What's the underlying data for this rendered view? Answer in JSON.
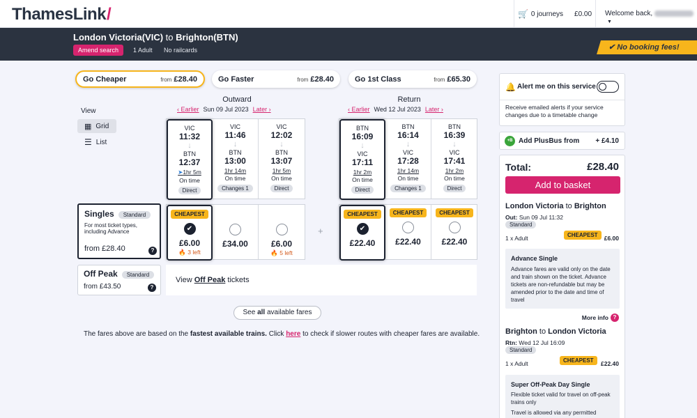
{
  "header": {
    "logo_text": "ThamesLink",
    "logo_slash": "/",
    "basket_journeys": "0 journeys",
    "basket_total": "£0.00",
    "welcome": "Welcome back,"
  },
  "journey": {
    "from": "London Victoria(VIC)",
    "to_word": "to",
    "to": "Brighton(BTN)",
    "amend_label": "Amend search",
    "passengers": "1 Adult",
    "railcards": "No railcards",
    "no_booking_fees": "No booking fees!"
  },
  "tabs": [
    {
      "label": "Go Cheaper",
      "from_word": "from",
      "price": "£28.40",
      "selected": true
    },
    {
      "label": "Go Faster",
      "from_word": "from",
      "price": "£28.40",
      "selected": false
    },
    {
      "label": "Go 1st Class",
      "from_word": "from",
      "price": "£65.30",
      "selected": false
    }
  ],
  "view": {
    "label": "View",
    "grid": "Grid",
    "list": "List"
  },
  "outward": {
    "title": "Outward",
    "earlier": "Earlier",
    "date": "Sun 09 Jul 2023",
    "later": "Later",
    "journeys": [
      {
        "from": "VIC",
        "dep": "11:32",
        "to": "BTN",
        "arr": "12:37",
        "duration": "1hr 5m",
        "status": "On time",
        "changes": "Direct",
        "selected": true
      },
      {
        "from": "VIC",
        "dep": "11:46",
        "to": "BTN",
        "arr": "13:00",
        "duration": "1hr 14m",
        "status": "On time",
        "changes": "Changes 1",
        "selected": false
      },
      {
        "from": "VIC",
        "dep": "12:02",
        "to": "BTN",
        "arr": "13:07",
        "duration": "1hr 5m",
        "status": "On time",
        "changes": "Direct",
        "selected": false
      }
    ],
    "fares": [
      {
        "badge": "CHEAPEST",
        "price": "£6.00",
        "left": "3 left",
        "selected": true
      },
      {
        "badge": "",
        "price": "£34.00",
        "left": "",
        "selected": false
      },
      {
        "badge": "",
        "price": "£6.00",
        "left": "5 left",
        "selected": false
      }
    ]
  },
  "return": {
    "title": "Return",
    "earlier": "Earlier",
    "date": "Wed 12 Jul 2023",
    "later": "Later",
    "journeys": [
      {
        "from": "BTN",
        "dep": "16:09",
        "to": "VIC",
        "arr": "17:11",
        "duration": "1hr 2m",
        "status": "On time",
        "changes": "Direct",
        "selected": true
      },
      {
        "from": "BTN",
        "dep": "16:14",
        "to": "VIC",
        "arr": "17:28",
        "duration": "1hr 14m",
        "status": "On time",
        "changes": "Changes 1",
        "selected": false
      },
      {
        "from": "BTN",
        "dep": "16:39",
        "to": "VIC",
        "arr": "17:41",
        "duration": "1hr 2m",
        "status": "On time",
        "changes": "Direct",
        "selected": false
      }
    ],
    "fares": [
      {
        "badge": "CHEAPEST",
        "price": "£22.40",
        "selected": true
      },
      {
        "badge": "CHEAPEST",
        "price": "£22.40",
        "selected": false
      },
      {
        "badge": "CHEAPEST",
        "price": "£22.40",
        "selected": false
      }
    ]
  },
  "plus": "+",
  "ticket_types": [
    {
      "name": "Singles",
      "class": "Standard",
      "desc": "For most ticket types, including Advance",
      "from": "from £28.40"
    },
    {
      "name": "Off Peak",
      "class": "Standard",
      "from": "from £43.50"
    }
  ],
  "offpeak": {
    "view": "View",
    "link": "Off Peak",
    "tail": "tickets"
  },
  "see_all": {
    "pre": "See",
    "bold": "all",
    "post": "available fares"
  },
  "footnote": {
    "pre": "The fares above are based on the",
    "bold": "fastest available trains.",
    "mid": "Click",
    "link": "here",
    "post": "to check if slower routes with cheaper fares are available."
  },
  "sidebar": {
    "alert_title": "Alert me on this service",
    "alert_desc": "Receive emailed alerts if your service changes due to a timetable change",
    "plusbus_label": "Add PlusBus from",
    "plusbus_price": "+ £4.10",
    "total_label": "Total:",
    "total": "£28.40",
    "add_basket": "Add to basket",
    "out": {
      "from": "London Victoria",
      "to_word": "to",
      "to": "Brighton",
      "date_label": "Out:",
      "date": "Sun 09 Jul 11:32",
      "class": "Standard",
      "pax": "1 x Adult",
      "badge": "CHEAPEST",
      "price": "£6.00",
      "ticket_title": "Advance Single",
      "ticket_desc": "Advance fares are valid only on the date and train shown on the ticket. Advance tickets are non-refundable but may be amended prior to the date and time of travel",
      "more": "More info"
    },
    "rtn": {
      "from": "Brighton",
      "to_word": "to",
      "to": "London Victoria",
      "date_label": "Rtn:",
      "date": "Wed 12 Jul 16:09",
      "class": "Standard",
      "pax": "1 x Adult",
      "badge": "CHEAPEST",
      "price": "£22.40",
      "ticket_title": "Super Off-Peak Day Single",
      "ticket_desc": "Flexible ticket valid for travel on off-peak trains only",
      "ticket_desc2": "Travel is allowed via any permitted"
    }
  }
}
